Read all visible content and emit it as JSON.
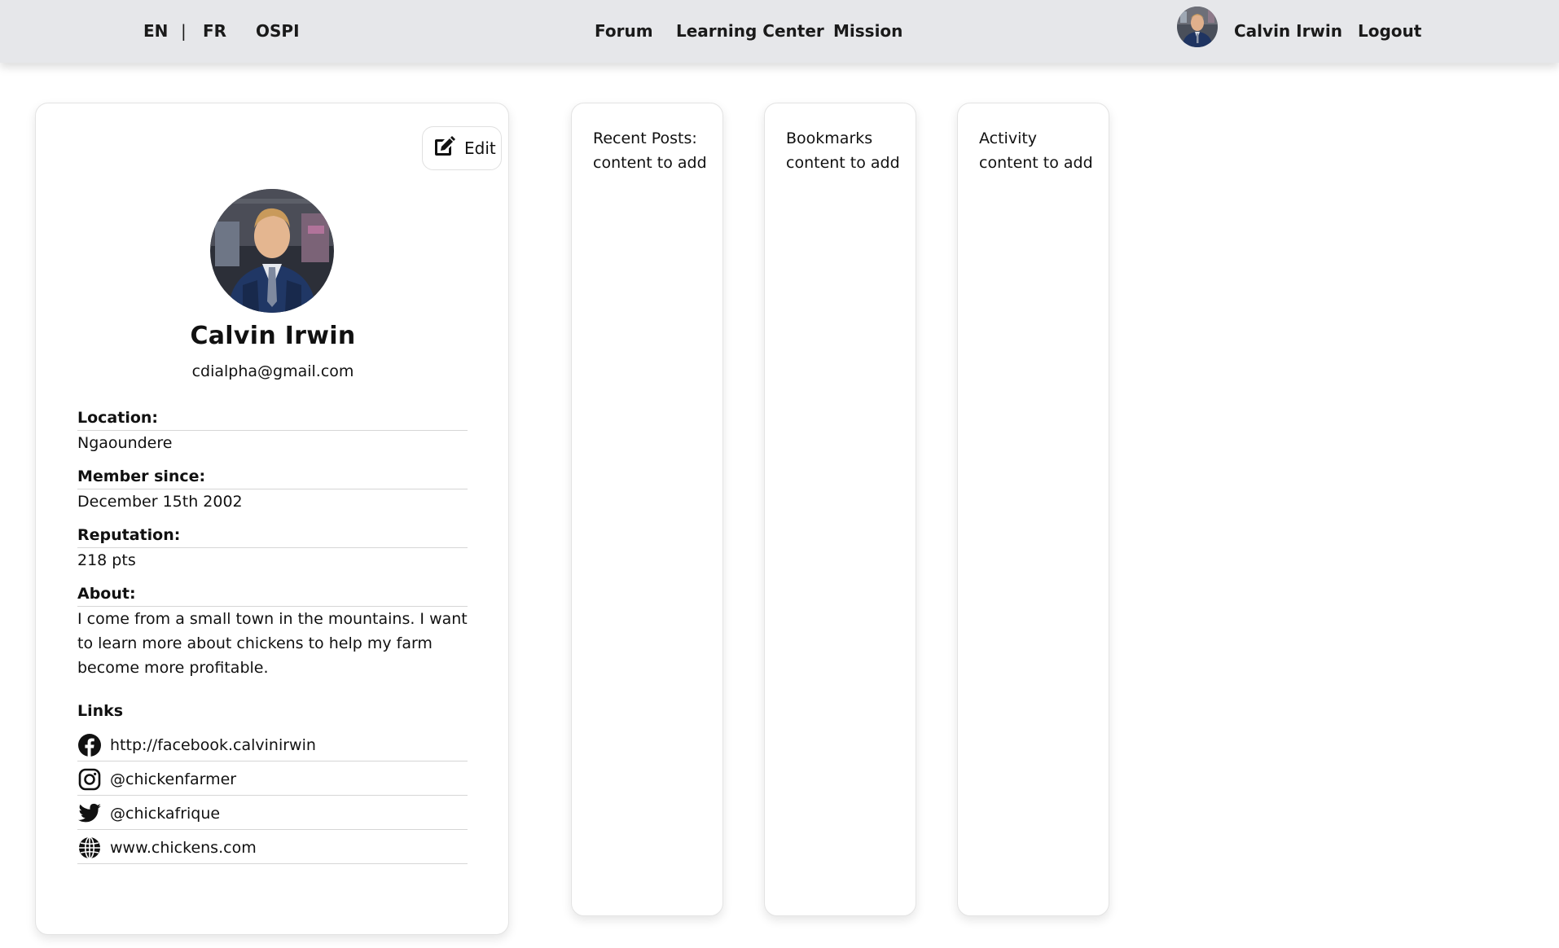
{
  "header": {
    "lang_en": "EN",
    "lang_sep": "|",
    "lang_fr": "FR",
    "brand": "OSPI",
    "nav": [
      "Forum",
      "Learning Center",
      "Mission"
    ],
    "user_name": "Calvin Irwin",
    "logout": "Logout"
  },
  "profile": {
    "edit_label": "Edit",
    "name": "Calvin Irwin",
    "email": "cdialpha@gmail.com",
    "location_label": "Location:",
    "location": "Ngaoundere",
    "member_since_label": "Member since:",
    "member_since": "December 15th 2002",
    "reputation_label": "Reputation:",
    "reputation": "218 pts",
    "about_label": "About:",
    "about": "I come from a small town in the mountains. I want to learn more about chickens to help my farm become more profitable.",
    "links_heading": "Links",
    "links": [
      {
        "icon": "facebook-icon",
        "text": "http://facebook.calvinirwin"
      },
      {
        "icon": "instagram-icon",
        "text": "@chickenfarmer"
      },
      {
        "icon": "twitter-icon",
        "text": "@chickafrique"
      },
      {
        "icon": "globe-icon",
        "text": "www.chickens.com"
      }
    ]
  },
  "panels": {
    "recent_posts": {
      "title": "Recent Posts:",
      "body": "content to add"
    },
    "bookmarks": {
      "title": "Bookmarks",
      "body": "content to add"
    },
    "activity": {
      "title": "Activity",
      "body": "content to add"
    }
  }
}
